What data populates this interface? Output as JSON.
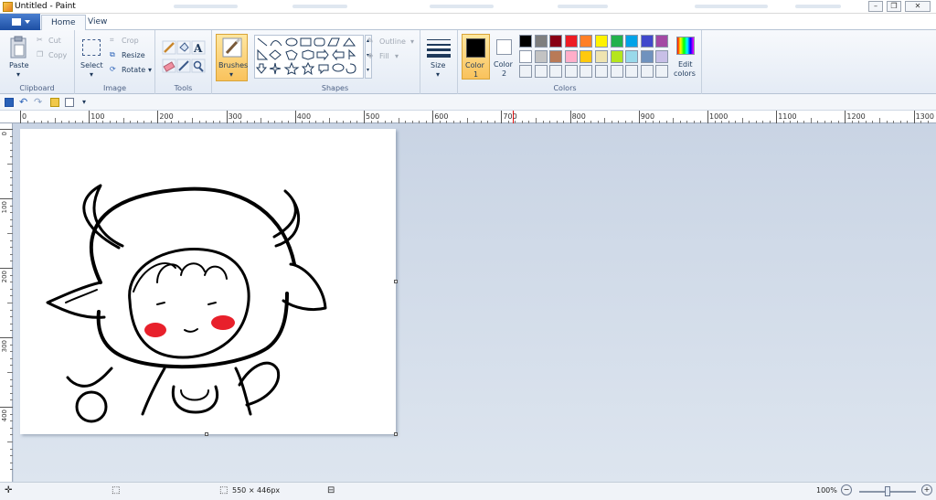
{
  "window": {
    "title": "Untitled - Paint"
  },
  "tabs": [
    {
      "label": "Home",
      "active": true
    },
    {
      "label": "View",
      "active": false
    }
  ],
  "ribbon": {
    "clipboard": {
      "label": "Clipboard",
      "paste": "Paste",
      "cut": "Cut",
      "copy": "Copy"
    },
    "image": {
      "label": "Image",
      "select": "Select",
      "crop": "Crop",
      "resize": "Resize",
      "rotate": "Rotate"
    },
    "tools": {
      "label": "Tools"
    },
    "brushes": {
      "label": "Brushes"
    },
    "shapes": {
      "label": "Shapes",
      "outline": "Outline",
      "fill": "Fill"
    },
    "size": {
      "label": "Size"
    },
    "colors": {
      "label": "Colors",
      "color1_label": "Color",
      "color1_num": "1",
      "color2_label": "Color",
      "color2_num": "2",
      "edit_label": "Edit",
      "edit_label2": "colors",
      "color1": "#000000",
      "color2": "#ffffff",
      "palette_row1": [
        "#000000",
        "#7f7f7f",
        "#880015",
        "#ed1c24",
        "#ff7f27",
        "#fff200",
        "#22b14c",
        "#00a2e8",
        "#3f48cc",
        "#a349a4"
      ],
      "palette_row2": [
        "#ffffff",
        "#c3c3c3",
        "#b97a57",
        "#ffaec9",
        "#ffc90e",
        "#efe4b0",
        "#b5e61d",
        "#99d9ea",
        "#7092be",
        "#c8bfe7"
      ]
    }
  },
  "ruler": {
    "horizontal": [
      "0",
      "100",
      "200",
      "300",
      "400",
      "500",
      "600",
      "700",
      "800",
      "900",
      "1000",
      "1100",
      "1200",
      "1300"
    ],
    "vertical": [
      "0",
      "100",
      "200",
      "300",
      "400"
    ]
  },
  "status": {
    "canvas_size": "550 × 446px",
    "zoom": "100%"
  }
}
